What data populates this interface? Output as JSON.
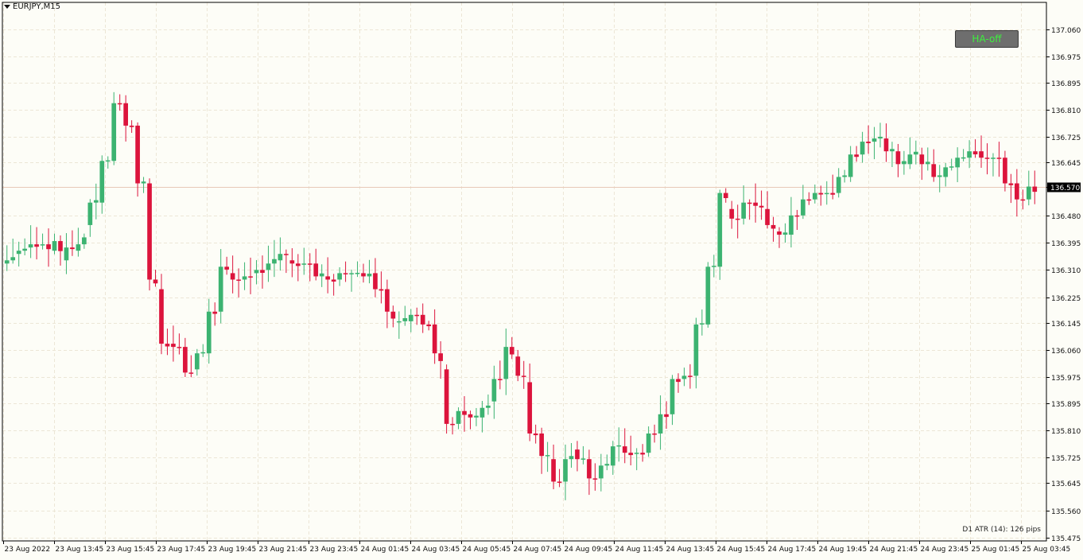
{
  "header": {
    "symbol": "EURJPY,M15"
  },
  "ha_button": {
    "label": "HA-off"
  },
  "indicator": {
    "atr_text": "D1 ATR (14): 126 pips"
  },
  "colors": {
    "bull": "#3cb371",
    "bear": "#dc143c",
    "grid": "#ece6d6",
    "background": "#fdfdf7",
    "axis": "#000000"
  },
  "chart_data": {
    "type": "candlestick",
    "title": "",
    "y_ticks": [
      "137.060",
      "136.975",
      "136.895",
      "136.810",
      "136.725",
      "136.645",
      "136.570",
      "136.480",
      "136.395",
      "136.310",
      "136.225",
      "136.145",
      "136.060",
      "135.975",
      "135.895",
      "135.810",
      "135.725",
      "135.645",
      "135.560",
      "135.475"
    ],
    "ylim": [
      135.475,
      137.06
    ],
    "grid": true,
    "current_price": "136.570",
    "x_ticks": [
      "23 Aug 2022",
      "23 Aug 13:45",
      "23 Aug 15:45",
      "23 Aug 17:45",
      "23 Aug 19:45",
      "23 Aug 21:45",
      "23 Aug 23:45",
      "24 Aug 01:45",
      "24 Aug 03:45",
      "24 Aug 05:45",
      "24 Aug 07:45",
      "24 Aug 09:45",
      "24 Aug 11:45",
      "24 Aug 13:45",
      "24 Aug 15:45",
      "24 Aug 17:45",
      "24 Aug 19:45",
      "24 Aug 21:45",
      "24 Aug 23:45",
      "25 Aug 01:45",
      "25 Aug 03:45"
    ],
    "anchors": [
      [
        136.33,
        136.34
      ],
      [
        136.36,
        136.37
      ],
      [
        136.38,
        136.39
      ],
      [
        136.39,
        136.39
      ],
      [
        136.37,
        136.4
      ],
      [
        136.34,
        136.38
      ],
      [
        136.37,
        136.39
      ],
      [
        136.45,
        136.52
      ],
      [
        136.52,
        136.65
      ],
      [
        136.65,
        136.83
      ],
      [
        136.83,
        136.76
      ],
      [
        136.76,
        136.58
      ],
      [
        136.58,
        136.28
      ],
      [
        136.25,
        136.08
      ],
      [
        136.08,
        136.07
      ],
      [
        136.07,
        135.99
      ],
      [
        136.0,
        136.05
      ],
      [
        136.05,
        136.18
      ],
      [
        136.18,
        136.32
      ],
      [
        136.3,
        136.28
      ],
      [
        136.28,
        136.29
      ],
      [
        136.3,
        136.31
      ],
      [
        136.31,
        136.33
      ],
      [
        136.34,
        136.36
      ],
      [
        136.34,
        136.33
      ],
      [
        136.33,
        136.33
      ],
      [
        136.33,
        136.29
      ],
      [
        136.29,
        136.28
      ],
      [
        136.28,
        136.3
      ],
      [
        136.3,
        136.3
      ],
      [
        136.3,
        136.29
      ],
      [
        136.3,
        136.25
      ],
      [
        136.25,
        136.18
      ],
      [
        136.15,
        136.15
      ],
      [
        136.15,
        136.17
      ],
      [
        136.17,
        136.14
      ],
      [
        136.14,
        136.05
      ],
      [
        136.0,
        135.83
      ],
      [
        135.83,
        135.87
      ],
      [
        135.86,
        135.85
      ],
      [
        135.85,
        135.88
      ],
      [
        135.9,
        135.97
      ],
      [
        135.97,
        136.07
      ],
      [
        136.04,
        135.98
      ],
      [
        135.96,
        135.8
      ],
      [
        135.8,
        135.73
      ],
      [
        135.72,
        135.65
      ],
      [
        135.65,
        135.72
      ],
      [
        135.75,
        135.72
      ],
      [
        135.72,
        135.66
      ],
      [
        135.66,
        135.7
      ],
      [
        135.7,
        135.76
      ],
      [
        135.76,
        135.74
      ],
      [
        135.74,
        135.74
      ],
      [
        135.74,
        135.8
      ],
      [
        135.8,
        135.86
      ],
      [
        135.86,
        135.97
      ],
      [
        135.97,
        135.98
      ],
      [
        135.98,
        136.14
      ],
      [
        136.14,
        136.32
      ],
      [
        136.32,
        136.55
      ],
      [
        136.5,
        136.47
      ],
      [
        136.47,
        136.52
      ],
      [
        136.52,
        136.51
      ],
      [
        136.5,
        136.45
      ],
      [
        136.43,
        136.42
      ],
      [
        136.42,
        136.48
      ],
      [
        136.48,
        136.53
      ],
      [
        136.53,
        136.55
      ],
      [
        136.55,
        136.55
      ],
      [
        136.55,
        136.6
      ],
      [
        136.6,
        136.67
      ],
      [
        136.67,
        136.71
      ],
      [
        136.71,
        136.72
      ],
      [
        136.72,
        136.68
      ],
      [
        136.68,
        136.64
      ],
      [
        136.64,
        136.67
      ],
      [
        136.67,
        136.64
      ],
      [
        136.64,
        136.6
      ],
      [
        136.6,
        136.63
      ],
      [
        136.63,
        136.66
      ],
      [
        136.66,
        136.68
      ],
      [
        136.68,
        136.66
      ],
      [
        136.66,
        136.66
      ],
      [
        136.66,
        136.58
      ],
      [
        136.58,
        136.53
      ],
      [
        136.53,
        136.57
      ]
    ]
  }
}
